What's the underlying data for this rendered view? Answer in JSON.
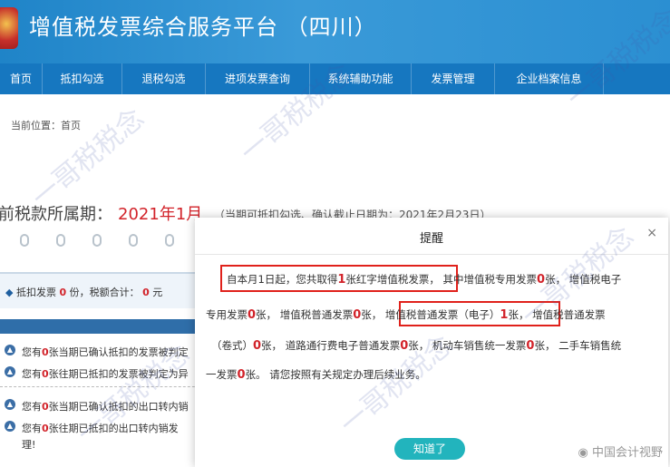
{
  "header": {
    "title": "增值税发票综合服务平台 （四川）"
  },
  "nav": {
    "items": [
      "首页",
      "抵扣勾选",
      "退税勾选",
      "进项发票查询",
      "系统辅助功能",
      "发票管理",
      "企业档案信息"
    ]
  },
  "breadcrumb": "当前位置：首页",
  "period": {
    "label": "前税款所属期：",
    "value": "2021年1月",
    "note": "（当期可抵扣勾选、确认截止日期为：2021年2月23日）"
  },
  "summary": {
    "label1": "抵扣发票",
    "count": "0",
    "label2": "份，税额合计：",
    "amount": "0",
    "unit": "元"
  },
  "notices": [
    {
      "pre": "您有",
      "count": "0",
      "post": "张当期已确认抵扣的发票被判定"
    },
    {
      "pre": "您有",
      "count": "0",
      "post": "张往期已抵扣的发票被判定为异"
    },
    {
      "pre": "您有",
      "count": "0",
      "post": "张当期已确认抵扣的出口转内销"
    },
    {
      "pre": "您有",
      "count": "0",
      "post": "张往期已抵扣的出口转内销发"
    }
  ],
  "notice_tail": "理!",
  "dialog": {
    "title": "提醒",
    "close": "×",
    "l1a": "自本月1日起，您共取得",
    "n1": "1",
    "l1b": "张红字增值税发票，",
    "l1c": "其中增值税专用发票",
    "n2": "0",
    "l1d": "张，  增值税电子",
    "l2a": "专用发票",
    "n3": "0",
    "l2b": "张，  增值税普通发票",
    "n4": "0",
    "l2c": "张，",
    "l2d": "增值税普通发票（电子）",
    "n5": "1",
    "l2e": "张，",
    "l2f": "增值税普通发票",
    "l3a": "（卷式）",
    "n6": "0",
    "l3b": "张，  道路通行费电子普通发票",
    "n7": "0",
    "l3c": "张，  机动车销售统一发票",
    "n8": "0",
    "l3d": "张，   二手车销售统",
    "l4a": "一发票",
    "n9": "0",
    "l4b": "张。 请您按照有关规定办理后续业务。",
    "ok": "知道了"
  },
  "watermark": "一哥税税念",
  "credit": "中国会计视野",
  "colors": {
    "brand": "#1f84c8",
    "nav": "#1677c0",
    "highlight": "#d2232a",
    "box": "#e0211b",
    "button": "#22b4bd"
  }
}
